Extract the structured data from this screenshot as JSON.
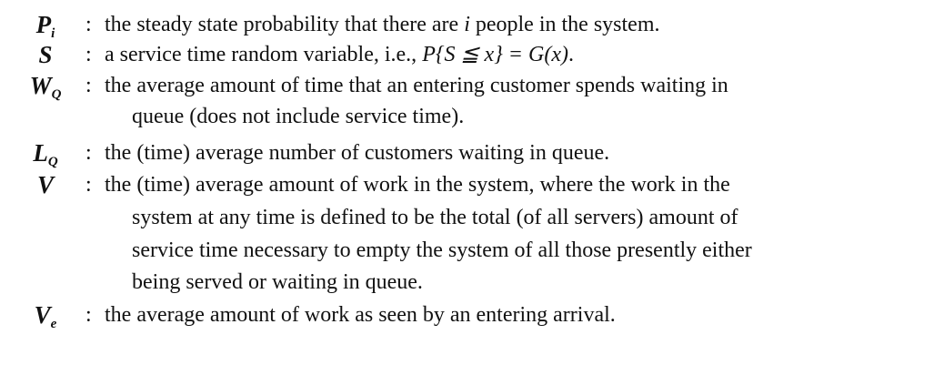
{
  "definitions": [
    {
      "symbol": "P",
      "subscript": "i",
      "text_a": "the steady state probability that there are ",
      "math_a": "i",
      "text_b": " people in the system."
    },
    {
      "symbol": "S",
      "text_a": "a service time random variable, i.e., ",
      "math_a": "P{S ≦ x} = G(x)",
      "text_b": "."
    },
    {
      "symbol": "W",
      "subscript": "Q",
      "lines": [
        "the average amount of time that an entering customer spends waiting in",
        "queue (does not include service time)."
      ]
    },
    {
      "symbol": "L",
      "subscript": "Q",
      "lines": [
        "the (time) average number of customers waiting in queue."
      ]
    },
    {
      "symbol": "V",
      "lines": [
        "the (time) average amount of work in the system, where the work in the",
        "system at any time is defined to be the total (of all servers) amount of",
        "service time necessary to empty the system of all those presently either",
        "being served or waiting in queue."
      ]
    },
    {
      "symbol": "V",
      "subscript": "e",
      "lines": [
        "the average amount of work as seen by an entering arrival."
      ]
    }
  ],
  "separator": ":"
}
